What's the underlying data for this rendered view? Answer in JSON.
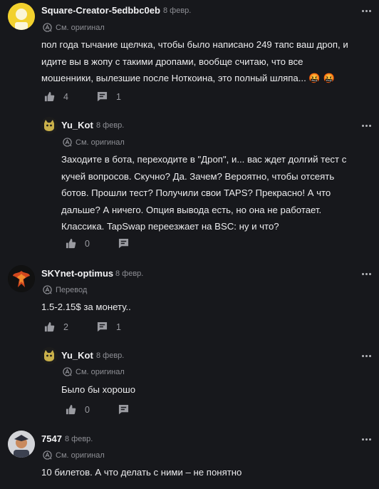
{
  "comments": [
    {
      "username": "Square-Creator-5edbbc0eb",
      "date": "8 февр.",
      "translation": "См. оригинал",
      "text_lines": [
        "пол года тычание щелчка, чтобы было написано 249 тапс ваш дроп, и",
        "идите вы в жопу с такими дропами, вообще считаю, что все",
        "мошенники, вылезшие после Ноткоина, это полный шляпа... 🤬 🤬"
      ],
      "likes": "4",
      "replies": "1"
    },
    {
      "username": "Yu_Kot",
      "date": "8 февр.",
      "translation": "См. оригинал",
      "text_lines": [
        "Заходите в бота, переходите в \"Дроп\", и... вас ждет долгий тест с",
        "кучей вопросов. Скучно? Да. Зачем? Вероятно, чтобы отсеять",
        "ботов. Прошли тест? Получили свои TAPS? Прекрасно! А что",
        "дальше? А ничего. Опция вывода есть, но она не работает.",
        "Классика. TapSwap переезжает на BSC: ну и что?"
      ],
      "likes": "0"
    },
    {
      "username": "SKYnet-optimus",
      "date": "8 февр.",
      "translation": "Перевод",
      "text_lines": [
        "1.5-2.15$ за монету.."
      ],
      "likes": "2",
      "replies": "1"
    },
    {
      "username": "Yu_Kot",
      "date": "8 февр.",
      "translation": "См. оригинал",
      "text_lines": [
        "Было бы хорошо"
      ],
      "likes": "0"
    },
    {
      "username": "7547",
      "date": "8 февр.",
      "translation": "См. оригинал",
      "text_lines": [
        "10 билетов. А что делать с ними – не понятно"
      ]
    }
  ],
  "colors": {
    "background": "#17181c",
    "text": "#ececee",
    "muted": "#8d8e94",
    "accent_avatar": "#f0cf2b"
  }
}
